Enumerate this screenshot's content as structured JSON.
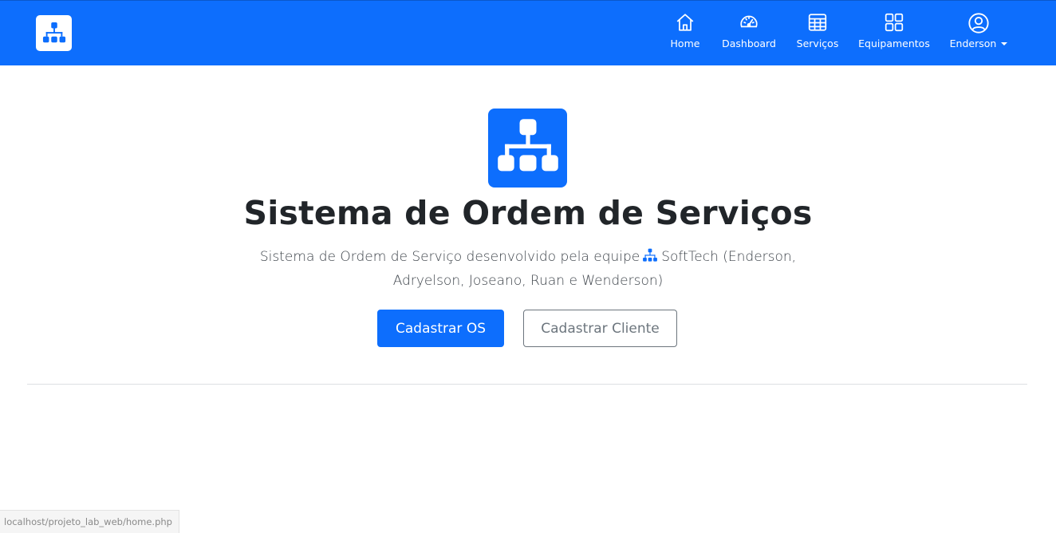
{
  "navbar": {
    "brand_icon": "sitemap-icon",
    "items": [
      {
        "label": "Home",
        "icon": "house-icon"
      },
      {
        "label": "Dashboard",
        "icon": "speedometer-icon"
      },
      {
        "label": "Serviços",
        "icon": "table-icon"
      },
      {
        "label": "Equipamentos",
        "icon": "grid-icon"
      },
      {
        "label": "Enderson",
        "icon": "person-circle-icon",
        "dropdown": true
      }
    ]
  },
  "hero": {
    "logo_icon": "sitemap-icon",
    "title": "Sistema de Ordem de Serviços",
    "lead_before": "Sistema de Ordem de Serviço desenvolvido pela equipe",
    "lead_icon": "sitemap-icon",
    "lead_after": "SoftTech (Enderson, Adryelson, Joseano, Ruan e Wenderson)",
    "primary_button": "Cadastrar OS",
    "secondary_button": "Cadastrar Cliente"
  },
  "status_bar": {
    "url": "localhost/projeto_lab_web/home.php"
  },
  "colors": {
    "primary": "#0d6efd",
    "text": "#212529",
    "secondary": "#6c757d"
  }
}
